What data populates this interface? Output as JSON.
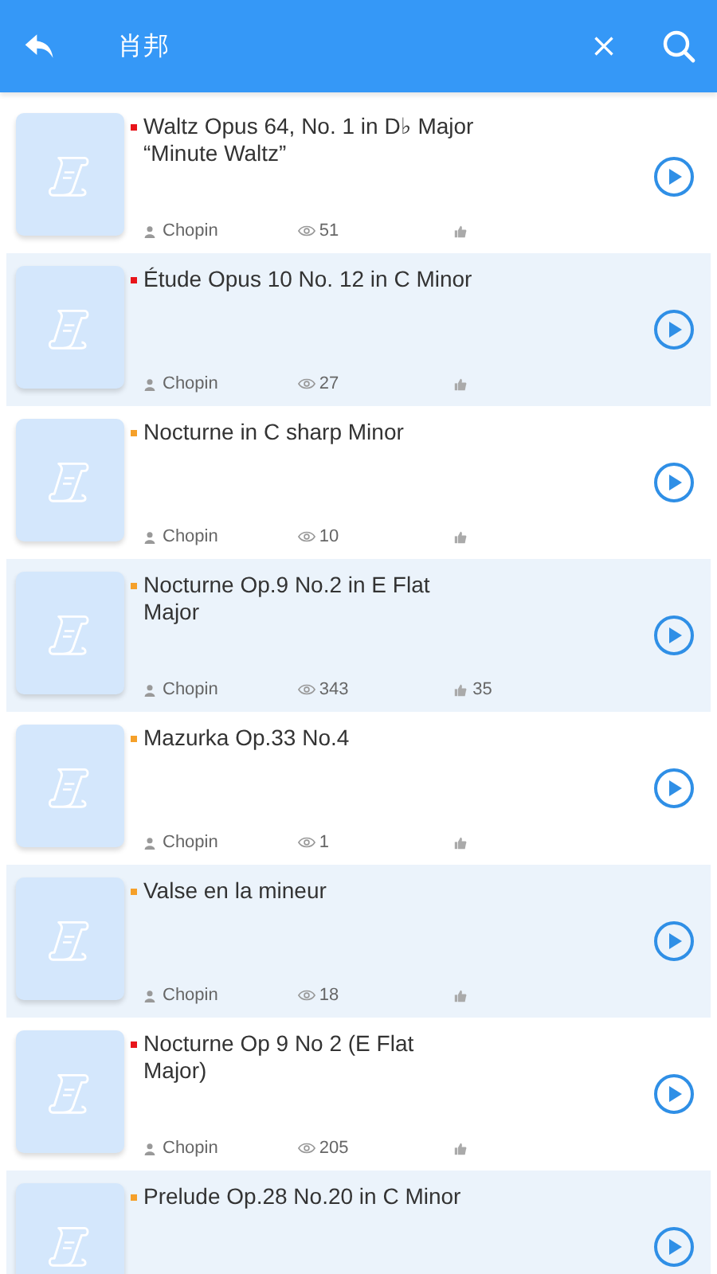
{
  "header": {
    "title": "肖邦"
  },
  "items": [
    {
      "title": "Waltz Opus 64, No. 1 in D♭ Major “Minute Waltz”",
      "color": "#e8141a",
      "author": "Chopin",
      "views": "51"
    },
    {
      "title": "Étude Opus 10 No. 12 in C Minor",
      "color": "#e8141a",
      "author": "Chopin",
      "views": "27"
    },
    {
      "title": "Nocturne in C sharp Minor",
      "color": "#f5a02a",
      "author": "Chopin",
      "views": "10"
    },
    {
      "title": "Nocturne Op.9 No.2 in E Flat Major",
      "color": "#f5a02a",
      "author": "Chopin",
      "views": "343",
      "likes": "35"
    },
    {
      "title": "Mazurka Op.33 No.4",
      "color": "#f5a02a",
      "author": "Chopin",
      "views": "1"
    },
    {
      "title": "Valse en la mineur",
      "color": "#f5a02a",
      "author": "Chopin",
      "views": "18"
    },
    {
      "title": "Nocturne Op 9 No 2 (E Flat Major)",
      "color": "#e8141a",
      "author": "Chopin",
      "views": "205"
    },
    {
      "title": "Prelude Op.28 No.20 in C Minor",
      "color": "#f5a02a"
    }
  ]
}
